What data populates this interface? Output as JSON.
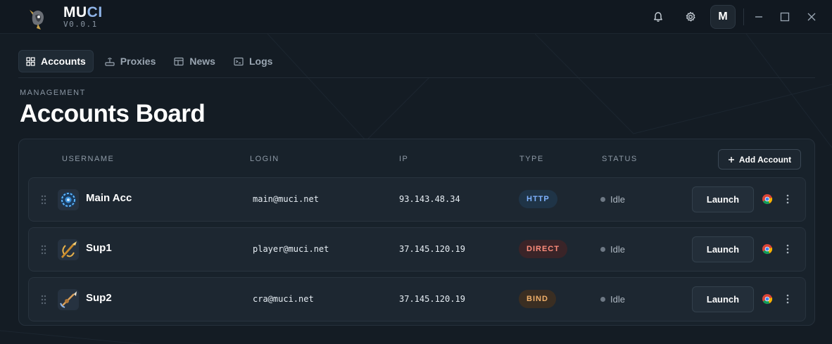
{
  "app": {
    "name_main": "MU",
    "name_accent": "CI",
    "version": "V0.0.1",
    "avatar_letter": "M"
  },
  "tabs": [
    {
      "label": "Accounts",
      "icon": "grid-icon",
      "active": true
    },
    {
      "label": "Proxies",
      "icon": "router-icon",
      "active": false
    },
    {
      "label": "News",
      "icon": "newspaper-icon",
      "active": false
    },
    {
      "label": "Logs",
      "icon": "terminal-icon",
      "active": false
    }
  ],
  "page": {
    "section": "MANAGEMENT",
    "title": "Accounts Board"
  },
  "table": {
    "columns": [
      "USERNAME",
      "LOGIN",
      "IP",
      "TYPE",
      "STATUS"
    ],
    "add_label": "Add Account",
    "rows": [
      {
        "username": "Main Acc",
        "login": "main@muci.net",
        "ip": "93.143.48.34",
        "type": "HTTP",
        "status": "Idle",
        "launch": "Launch",
        "avatar": "rune-avatar"
      },
      {
        "username": "Sup1",
        "login": "player@muci.net",
        "ip": "37.145.120.19",
        "type": "DIRECT",
        "status": "Idle",
        "launch": "Launch",
        "avatar": "bow-avatar"
      },
      {
        "username": "Sup2",
        "login": "cra@muci.net",
        "ip": "37.145.120.19",
        "type": "BIND",
        "status": "Idle",
        "launch": "Launch",
        "avatar": "arrow-avatar"
      }
    ]
  },
  "colors": {
    "http": "#7fb2ff",
    "direct": "#ff8e7c",
    "bind": "#f0b06a"
  }
}
